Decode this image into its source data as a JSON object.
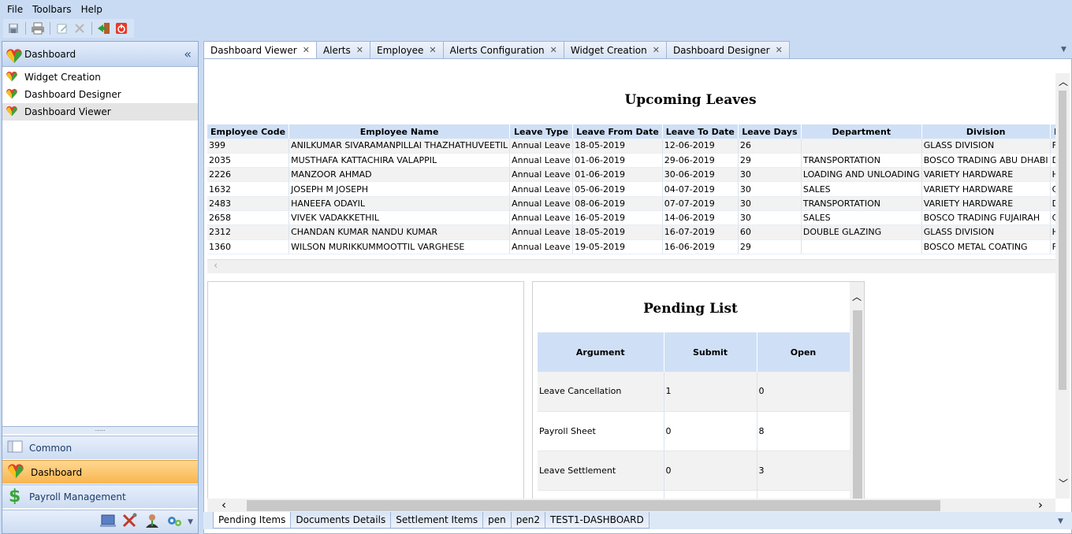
{
  "menu": [
    "File",
    "Toolbars",
    "Help"
  ],
  "toolbar": {
    "icons": [
      "save-icon",
      "print-icon",
      "edit-icon",
      "delete-icon",
      "exit-icon",
      "power-icon"
    ]
  },
  "nav": {
    "header": "Dashboard",
    "items": [
      {
        "label": "Widget Creation"
      },
      {
        "label": "Dashboard Designer"
      },
      {
        "label": "Dashboard Viewer",
        "selected": true
      }
    ],
    "modules": [
      {
        "label": "Common"
      },
      {
        "label": "Dashboard",
        "active": true
      },
      {
        "label": "Payroll Management"
      }
    ]
  },
  "tabs": [
    {
      "label": "Dashboard Viewer",
      "active": true
    },
    {
      "label": "Alerts"
    },
    {
      "label": "Employee"
    },
    {
      "label": "Alerts Configuration"
    },
    {
      "label": "Widget Creation"
    },
    {
      "label": "Dashboard Designer"
    }
  ],
  "upcoming": {
    "title": "Upcoming Leaves",
    "columns": [
      "Employee Code",
      "Employee Name",
      "Leave Type",
      "Leave From Date",
      "Leave To Date",
      "Leave Days",
      "Department",
      "Division",
      "Designa"
    ],
    "rows": [
      [
        "399",
        "ANILKUMAR SIVARAMANPILLAI THAZHATHUVEETIL",
        "Annual Leave",
        "18-05-2019",
        "12-06-2019",
        "26",
        "",
        "GLASS DIVISION",
        "FOREMAN"
      ],
      [
        "2035",
        "MUSTHAFA KATTACHIRA VALAPPIL",
        "Annual Leave",
        "01-06-2019",
        "29-06-2019",
        "29",
        "TRANSPORTATION",
        "BOSCO TRADING ABU DHABI",
        "DRIVER"
      ],
      [
        "2226",
        "MANZOOR AHMAD",
        "Annual Leave",
        "01-06-2019",
        "30-06-2019",
        "30",
        "LOADING AND UNLOADING",
        "VARIETY HARDWARE",
        "HELPER"
      ],
      [
        "1632",
        "JOSEPH M JOSEPH",
        "Annual Leave",
        "05-06-2019",
        "04-07-2019",
        "30",
        "SALES",
        "VARIETY HARDWARE",
        "COUNTER"
      ],
      [
        "2483",
        "HANEEFA ODAYIL",
        "Annual Leave",
        "08-06-2019",
        "07-07-2019",
        "30",
        "TRANSPORTATION",
        "VARIETY HARDWARE",
        "DRIVER"
      ],
      [
        "2658",
        "VIVEK VADAKKETHIL",
        "Annual Leave",
        "16-05-2019",
        "14-06-2019",
        "30",
        "SALES",
        "BOSCO TRADING FUJAIRAH",
        "COUNTER"
      ],
      [
        "2312",
        "CHANDAN KUMAR NANDU KUMAR",
        "Annual Leave",
        "18-05-2019",
        "16-07-2019",
        "60",
        "DOUBLE GLAZING",
        "GLASS DIVISION",
        "HELPER"
      ],
      [
        "1360",
        "WILSON MURIKKUMMOOTTIL VARGHESE",
        "Annual Leave",
        "19-05-2019",
        "16-06-2019",
        "29",
        "",
        "BOSCO METAL COATING",
        "FOREMAN"
      ]
    ]
  },
  "pending": {
    "title": "Pending List",
    "columns": [
      "Argument",
      "Submit",
      "Open"
    ],
    "rows": [
      [
        "Leave Cancellation",
        "1",
        "0"
      ],
      [
        "Payroll Sheet",
        "0",
        "8"
      ],
      [
        "Leave Settlement",
        "0",
        "3"
      ],
      [
        "",
        "",
        ""
      ]
    ]
  },
  "bottom_tabs": [
    {
      "label": "Pending Items",
      "active": true
    },
    {
      "label": "Documents Details"
    },
    {
      "label": "Settlement Items"
    },
    {
      "label": "pen"
    },
    {
      "label": "pen2"
    },
    {
      "label": "TEST1-DASHBOARD"
    }
  ]
}
